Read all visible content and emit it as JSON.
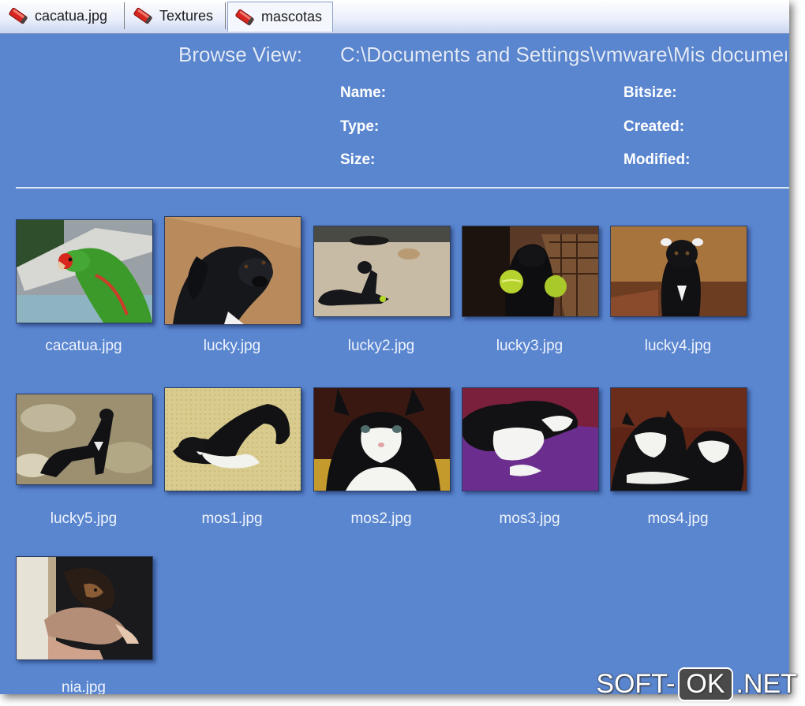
{
  "tabs": [
    {
      "label": "cacatua.jpg",
      "icon": "image-pen-icon"
    },
    {
      "label": "Textures",
      "icon": "image-pen-icon"
    },
    {
      "label": "mascotas",
      "icon": "image-pen-icon",
      "active": true
    }
  ],
  "header": {
    "title": "Browse View:",
    "path": "C:\\Documents and Settings\\vmware\\Mis documentos\\mascotas",
    "props": {
      "name": "Name:",
      "type": "Type:",
      "size": "Size:",
      "bitsize": "Bitsize:",
      "created": "Created:",
      "modified": "Modified:"
    }
  },
  "thumbnails": [
    {
      "file": "cacatua.jpg",
      "scene": "parrot"
    },
    {
      "file": "lucky.jpg",
      "scene": "dog-closeup"
    },
    {
      "file": "lucky2.jpg",
      "scene": "dog-floor"
    },
    {
      "file": "lucky3.jpg",
      "scene": "dog-balls"
    },
    {
      "file": "lucky4.jpg",
      "scene": "dog-sitting"
    },
    {
      "file": "lucky5.jpg",
      "scene": "dog-garden"
    },
    {
      "file": "mos1.jpg",
      "scene": "cat-lying"
    },
    {
      "file": "mos2.jpg",
      "scene": "kitten-front"
    },
    {
      "file": "mos3.jpg",
      "scene": "kitten-purple"
    },
    {
      "file": "mos4.jpg",
      "scene": "two-kittens"
    },
    {
      "file": "nia.jpg",
      "scene": "puppy-held"
    }
  ],
  "watermark": {
    "left": "SOFT-",
    "middle": "OK",
    "right": ".NET"
  },
  "colors": {
    "background": "#5a86d0",
    "tab_active": "#f4f7fd"
  }
}
